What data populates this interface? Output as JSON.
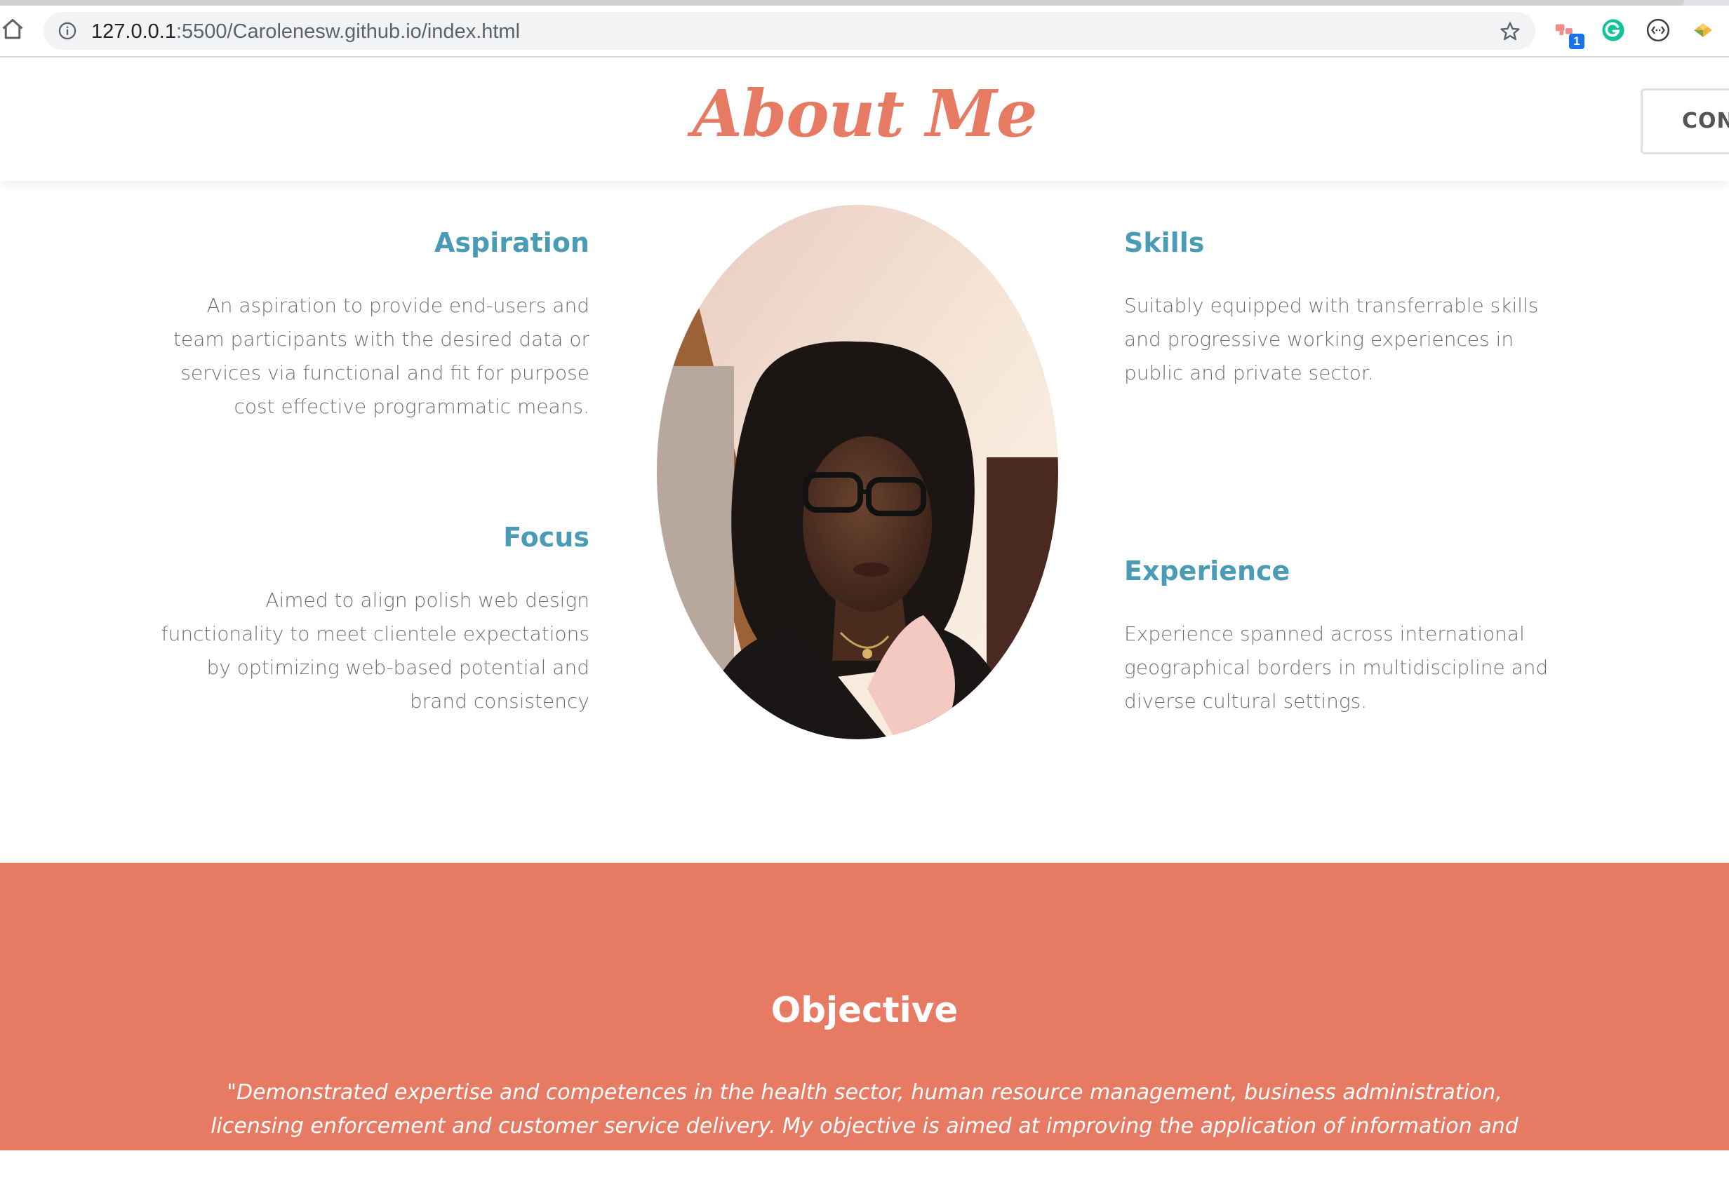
{
  "browser": {
    "url_host": "127.0.0.1",
    "url_rest": ":5500/Carolenesw.github.io/index.html",
    "extension_badge": "1"
  },
  "header": {
    "title": "About Me",
    "contact_label": "CON"
  },
  "about": {
    "aspiration": {
      "title": "Aspiration",
      "text": "An aspiration to provide end-users and team participants with the desired data or services via functional and fit for purpose cost effective programmatic means."
    },
    "focus": {
      "title": "Focus",
      "text": "Aimed to align polish web design functionality to meet clientele expectations by optimizing web-based potential and brand consistency"
    },
    "skills": {
      "title": "Skills",
      "text": "Suitably equipped with transferrable skills and progressive working experiences in public and private sector."
    },
    "experience": {
      "title": "Experience",
      "text": "Experience spanned across international geographical borders in multidiscipline and diverse cultural settings."
    }
  },
  "objective": {
    "title": "Objective",
    "text": "\"Demonstrated expertise and competences in the health sector, human resource management, business administration, licensing enforcement and customer service delivery. My objective is aimed at improving the application of information and communication technologies to increase"
  },
  "colors": {
    "accent": "#e67a62",
    "heading_blue": "#4a9bb6",
    "body_text": "#707070"
  }
}
